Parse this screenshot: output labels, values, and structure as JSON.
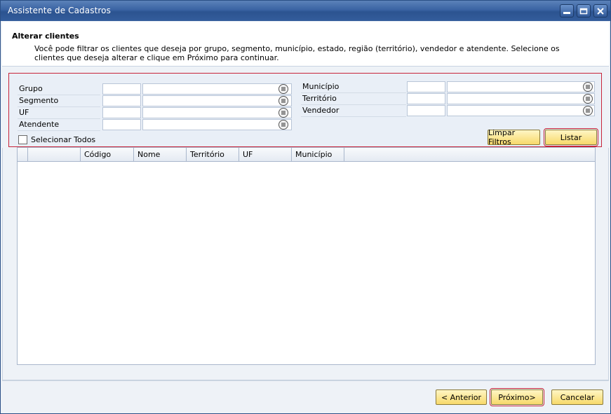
{
  "window": {
    "title": "Assistente de Cadastros"
  },
  "header": {
    "title": "Alterar clientes",
    "description": "Você pode filtrar os clientes que deseja por grupo, segmento, município, estado, região (território), vendedor e atendente. Selecione os clientes que deseja alterar e clique em Próximo para continuar."
  },
  "filters": {
    "left": [
      {
        "label": "Grupo",
        "code": "",
        "name": ""
      },
      {
        "label": "Segmento",
        "code": "",
        "name": ""
      },
      {
        "label": "UF",
        "code": "",
        "name": ""
      },
      {
        "label": "Atendente",
        "code": "",
        "name": ""
      }
    ],
    "right": [
      {
        "label": "Município",
        "code": "",
        "name": ""
      },
      {
        "label": "Território",
        "code": "",
        "name": ""
      },
      {
        "label": "Vendedor",
        "code": "",
        "name": ""
      }
    ],
    "select_all_label": "Selecionar Todos",
    "select_all_checked": false,
    "clear_button": "Limpar Filtros",
    "list_button": "Listar"
  },
  "grid": {
    "columns": [
      "",
      "",
      "Código",
      "Nome",
      "Território",
      "UF",
      "Município"
    ],
    "rows": []
  },
  "footer": {
    "prev_button": "< Anterior",
    "next_button": "Próximo>",
    "cancel_button": "Cancelar"
  },
  "icons": {
    "minimize": "minimize-icon",
    "maximize": "maximize-icon",
    "close": "close-icon",
    "picker": "list-picker-icon"
  }
}
